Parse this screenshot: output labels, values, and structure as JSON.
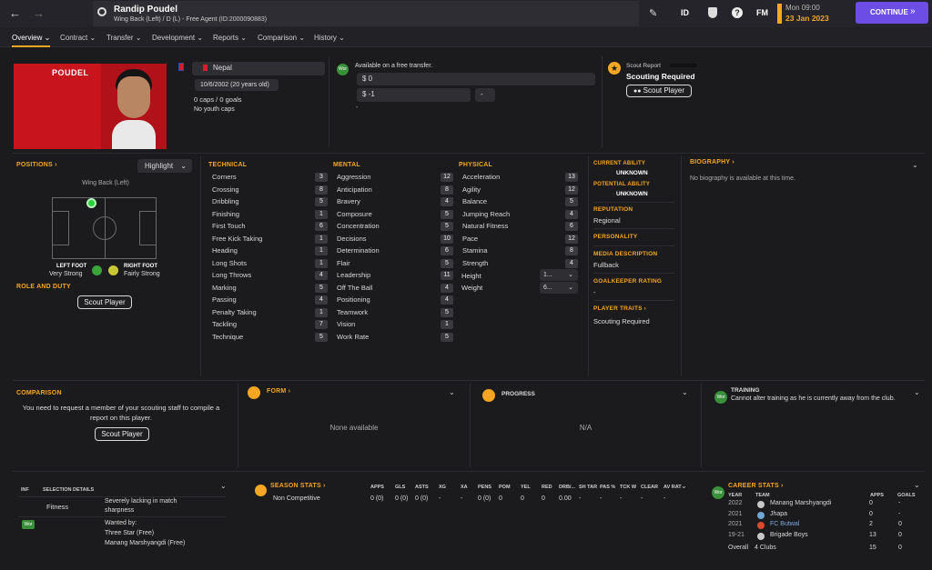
{
  "header": {
    "player_name": "Randip Poudel",
    "player_sub": "Wing Back (Left) / D (L) - Free Agent (ID:2000090883)",
    "id_label": "ID",
    "fm_label": "FM",
    "day_time": "Mon 09:00",
    "date": "23 Jan 2023",
    "continue_label": "CONTINUE"
  },
  "tabs": [
    "Overview",
    "Contract",
    "Transfer",
    "Development",
    "Reports",
    "Comparison",
    "History"
  ],
  "profile": {
    "shirt_name": "POUDEL",
    "nation": "Nepal",
    "dob": "10/6/2002 (20 years old)",
    "caps": "0 caps / 0 goals",
    "youth_caps": "No youth caps",
    "transfer_status": "Available on a free transfer.",
    "value1": "$ 0",
    "value2": "$ -1",
    "value2_extra": "-",
    "value_dash": "-",
    "scout_report_label": "Scout Report",
    "scouting_required": "Scouting Required",
    "scout_player_label": "Scout Player"
  },
  "positions": {
    "title": "POSITIONS",
    "highlight_label": "Highlight",
    "position_name": "Wing Back (Left)",
    "left_foot_label": "LEFT FOOT",
    "left_foot_value": "Very Strong",
    "right_foot_label": "RIGHT FOOT",
    "right_foot_value": "Fairly Strong",
    "role_title": "ROLE AND DUTY",
    "scout_player_label": "Scout Player"
  },
  "attributes": {
    "technical_title": "TECHNICAL",
    "mental_title": "MENTAL",
    "physical_title": "PHYSICAL",
    "technical": [
      {
        "name": "Corners",
        "value": "3"
      },
      {
        "name": "Crossing",
        "value": "8"
      },
      {
        "name": "Dribbling",
        "value": "5"
      },
      {
        "name": "Finishing",
        "value": "1"
      },
      {
        "name": "First Touch",
        "value": "6"
      },
      {
        "name": "Free Kick Taking",
        "value": "1"
      },
      {
        "name": "Heading",
        "value": "1"
      },
      {
        "name": "Long Shots",
        "value": "1"
      },
      {
        "name": "Long Throws",
        "value": "4"
      },
      {
        "name": "Marking",
        "value": "5"
      },
      {
        "name": "Passing",
        "value": "4"
      },
      {
        "name": "Penalty Taking",
        "value": "1"
      },
      {
        "name": "Tackling",
        "value": "7"
      },
      {
        "name": "Technique",
        "value": "5"
      }
    ],
    "mental": [
      {
        "name": "Aggression",
        "value": "12"
      },
      {
        "name": "Anticipation",
        "value": "8"
      },
      {
        "name": "Bravery",
        "value": "4"
      },
      {
        "name": "Composure",
        "value": "5"
      },
      {
        "name": "Concentration",
        "value": "5"
      },
      {
        "name": "Decisions",
        "value": "10"
      },
      {
        "name": "Determination",
        "value": "6"
      },
      {
        "name": "Flair",
        "value": "5"
      },
      {
        "name": "Leadership",
        "value": "11"
      },
      {
        "name": "Off The Ball",
        "value": "4"
      },
      {
        "name": "Positioning",
        "value": "4"
      },
      {
        "name": "Teamwork",
        "value": "5"
      },
      {
        "name": "Vision",
        "value": "1"
      },
      {
        "name": "Work Rate",
        "value": "5"
      }
    ],
    "physical": [
      {
        "name": "Acceleration",
        "value": "13"
      },
      {
        "name": "Agility",
        "value": "12"
      },
      {
        "name": "Balance",
        "value": "5"
      },
      {
        "name": "Jumping Reach",
        "value": "4"
      },
      {
        "name": "Natural Fitness",
        "value": "6"
      },
      {
        "name": "Pace",
        "value": "12"
      },
      {
        "name": "Stamina",
        "value": "8"
      },
      {
        "name": "Strength",
        "value": "4"
      }
    ],
    "height_label": "Height",
    "height_value": "1...",
    "weight_label": "Weight",
    "weight_value": "6..."
  },
  "ability": {
    "current_label": "CURRENT ABILITY",
    "current_value": "UNKNOWN",
    "potential_label": "POTENTIAL ABILITY",
    "potential_value": "UNKNOWN",
    "reputation_label": "REPUTATION",
    "reputation_value": "Regional",
    "personality_label": "PERSONALITY",
    "media_label": "MEDIA DESCRIPTION",
    "media_value": "Fullback",
    "gk_label": "GOALKEEPER RATING",
    "gk_value": "-",
    "traits_label": "PLAYER TRAITS",
    "traits_value": "Scouting Required"
  },
  "biography": {
    "title": "BIOGRAPHY",
    "text": "No biography is available at this time."
  },
  "comparison": {
    "title": "COMPARISON",
    "text": "You need to request a member of your scouting staff to compile a report on this player.",
    "button": "Scout Player"
  },
  "form": {
    "title": "FORM",
    "text": "None available"
  },
  "progress": {
    "title": "PROGRESS",
    "text": "N/A"
  },
  "training": {
    "title": "TRAINING",
    "text": "Cannot alter training as he is currently away from the club."
  },
  "inf": {
    "col1": "INF",
    "col2": "SELECTION DETAILS",
    "fitness_label": "Fitness",
    "fitness_value": "Severely lacking in match sharpness",
    "wanted_label": "Wanted by:",
    "wanted_1": "Three Star (Free)",
    "wanted_2": "Manang Marshyangdi (Free)"
  },
  "season_stats": {
    "title": "SEASON STATS",
    "headers": [
      "APPS",
      "GLS",
      "ASTS",
      "XG",
      "XA",
      "PENS",
      "POM",
      "YEL",
      "RED",
      "DRB/...",
      "SH TAR",
      "PAS %",
      "TCK W",
      "CLEAR",
      "AV RAT"
    ],
    "row_label": "Non Competitive",
    "row": [
      "0 (0)",
      "0 (0)",
      "0 (0)",
      "-",
      "-",
      "0 (0)",
      "0",
      "0",
      "0",
      "0.00",
      "-",
      "-",
      "-",
      "-",
      "-"
    ]
  },
  "career_stats": {
    "title": "CAREER STATS",
    "headers": {
      "year": "YEAR",
      "team": "TEAM",
      "apps": "APPS",
      "goals": "GOALS"
    },
    "rows": [
      {
        "year": "2022",
        "team": "Manang Marshyangdi",
        "apps": "0",
        "goals": "-"
      },
      {
        "year": "2021",
        "team": "Jhapa",
        "apps": "0",
        "goals": "-"
      },
      {
        "year": "2021",
        "team": "FC Butwal",
        "apps": "2",
        "goals": "0"
      },
      {
        "year": "19-21",
        "team": "Brigade Boys",
        "apps": "13",
        "goals": "0"
      }
    ],
    "overall_label": "Overall",
    "overall_clubs": "4 Clubs",
    "overall_apps": "15",
    "overall_goals": "0"
  },
  "colors": {
    "accent": "#f5a623",
    "continue": "#6c4ee6",
    "background": "#1b1b1d"
  }
}
